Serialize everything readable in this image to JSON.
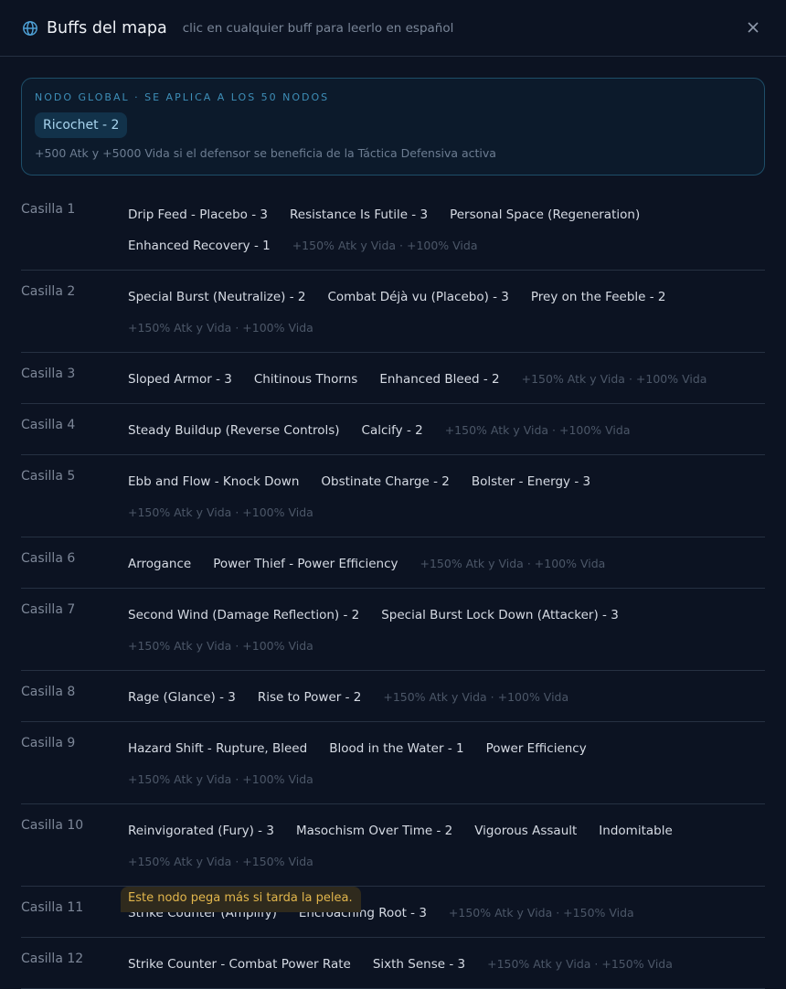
{
  "header": {
    "title": "Buffs del mapa",
    "subtitle": "clic en cualquier buff para leerlo en español"
  },
  "global": {
    "label": "NODO GLOBAL · SE APLICA A LOS 50 NODOS",
    "buff": "Ricochet - 2",
    "description": "+500 Atk y +5000 Vida si el defensor se beneficia de la Táctica Defensiva activa"
  },
  "rows": [
    {
      "label": "Casilla 1",
      "buffs": [
        "Drip Feed - Placebo - 3",
        "Resistance Is Futile - 3",
        "Personal Space (Regeneration)",
        "Enhanced Recovery - 1"
      ],
      "meta": "+150% Atk y Vida · +100% Vida"
    },
    {
      "label": "Casilla 2",
      "buffs": [
        "Special Burst (Neutralize) - 2",
        "Combat Déjà vu (Placebo) - 3",
        "Prey on the Feeble - 2"
      ],
      "meta": "+150% Atk y Vida · +100% Vida"
    },
    {
      "label": "Casilla 3",
      "buffs": [
        "Sloped Armor - 3",
        "Chitinous Thorns",
        "Enhanced Bleed - 2"
      ],
      "meta": "+150% Atk y Vida · +100% Vida"
    },
    {
      "label": "Casilla 4",
      "buffs": [
        "Steady Buildup (Reverse Controls)",
        "Calcify - 2"
      ],
      "meta": "+150% Atk y Vida · +100% Vida"
    },
    {
      "label": "Casilla 5",
      "buffs": [
        "Ebb and Flow - Knock Down",
        "Obstinate Charge - 2",
        "Bolster - Energy - 3"
      ],
      "meta": "+150% Atk y Vida · +100% Vida"
    },
    {
      "label": "Casilla 6",
      "buffs": [
        "Arrogance",
        "Power Thief - Power Efficiency"
      ],
      "meta": "+150% Atk y Vida · +100% Vida"
    },
    {
      "label": "Casilla 7",
      "buffs": [
        "Second Wind (Damage Reflection) - 2",
        "Special Burst Lock Down (Attacker) - 3"
      ],
      "meta": "+150% Atk y Vida · +100% Vida"
    },
    {
      "label": "Casilla 8",
      "buffs": [
        "Rage (Glance) - 3",
        "Rise to Power - 2"
      ],
      "meta": "+150% Atk y Vida · +100% Vida"
    },
    {
      "label": "Casilla 9",
      "buffs": [
        "Hazard Shift - Rupture, Bleed",
        "Blood in the Water - 1",
        "Power Efficiency"
      ],
      "meta": "+150% Atk y Vida · +100% Vida"
    },
    {
      "label": "Casilla 10",
      "buffs": [
        "Reinvigorated (Fury) - 3",
        "Masochism Over Time - 2",
        "Vigorous Assault",
        "Indomitable"
      ],
      "meta": "+150% Atk y Vida · +150% Vida"
    },
    {
      "label": "Casilla 11",
      "buffs": [
        "Strike Counter (Amplify)",
        "Encroaching Root - 3"
      ],
      "meta": "+150% Atk y Vida · +150% Vida"
    },
    {
      "label": "Casilla 12",
      "buffs": [
        "Strike Counter - Combat Power Rate",
        "Sixth Sense - 3"
      ],
      "meta": "+150% Atk y Vida · +150% Vida"
    }
  ],
  "toast": "Este nodo pega más si tarda la pelea."
}
